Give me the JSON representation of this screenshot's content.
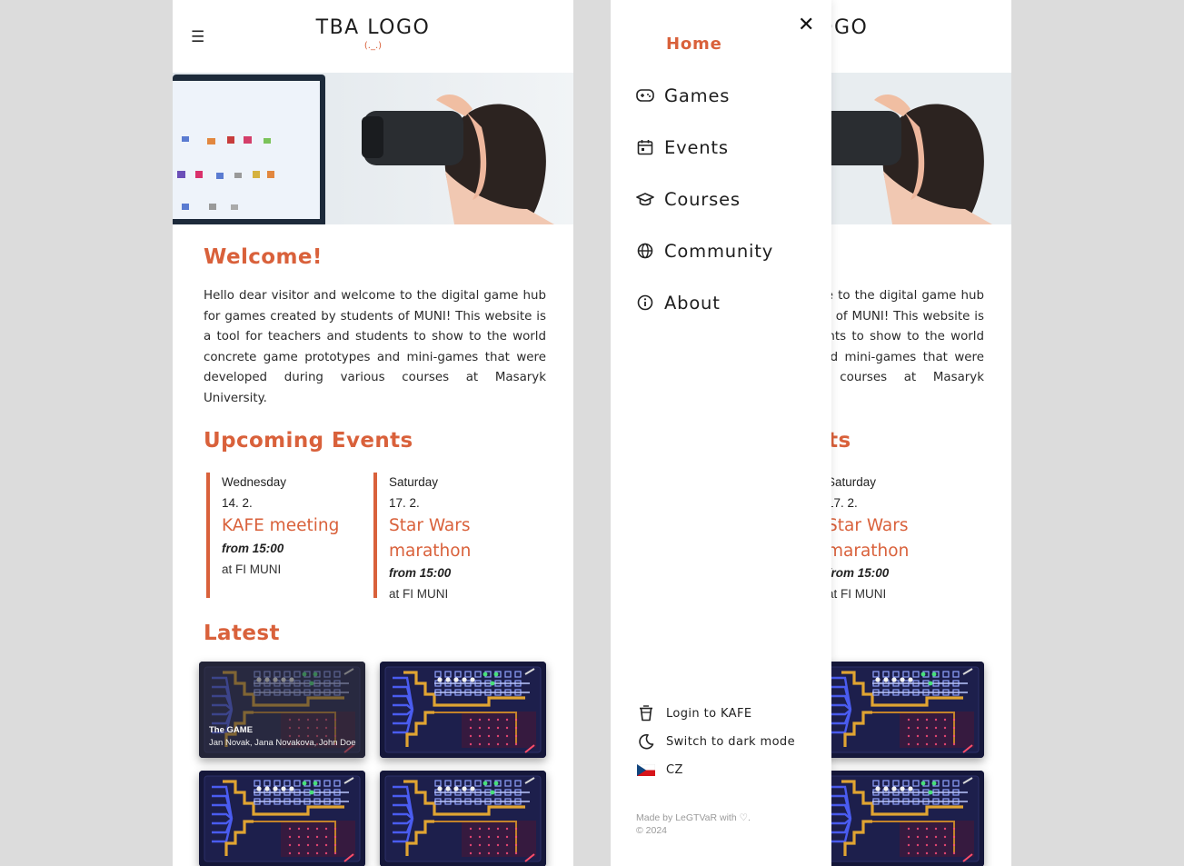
{
  "header": {
    "logo_text": "TBA LOGO",
    "logo_face": "(._.)",
    "menu_icon": "hamburger-icon"
  },
  "welcome": {
    "title": "Welcome!",
    "text": "Hello dear visitor and welcome to the digital game hub for games created by students of MUNI! This website is a tool for teachers and students to show to the world concrete game prototypes and mini-games that were developed during various courses at Masaryk University."
  },
  "events": {
    "title": "Upcoming Events",
    "items": [
      {
        "day": "Wednesday",
        "date": "14. 2.",
        "name": "KAFE meeting",
        "time": "from 15:00",
        "place": "at FI MUNI"
      },
      {
        "day": "Saturday",
        "date": "17. 2.",
        "name": "Star Wars marathon",
        "time": "from 15:00",
        "place": "at FI MUNI"
      }
    ]
  },
  "latest": {
    "title": "Latest",
    "cards": [
      {
        "title": "The GAME",
        "authors": "Jan Novak, Jana Novakova, John Doe"
      }
    ]
  },
  "drawer": {
    "close_icon": "close-icon",
    "nav": [
      {
        "label": "Home",
        "icon": "none"
      },
      {
        "label": "Games",
        "icon": "gamepad-icon"
      },
      {
        "label": "Events",
        "icon": "calendar-icon"
      },
      {
        "label": "Courses",
        "icon": "graduation-cap-icon"
      },
      {
        "label": "Community",
        "icon": "globe-icon"
      },
      {
        "label": "About",
        "icon": "info-icon"
      }
    ],
    "utilities": [
      {
        "label": "Login to KAFE",
        "icon": "cup-icon"
      },
      {
        "label": "Switch to dark mode",
        "icon": "moon-icon"
      },
      {
        "label": "CZ",
        "icon": "czech-flag-icon"
      }
    ],
    "footer_made": "Made by LeGTVaR with ♡.",
    "footer_year": "© 2024"
  },
  "colors": {
    "accent": "#d9613b",
    "background": "#dcdcdc",
    "text": "#222222"
  }
}
